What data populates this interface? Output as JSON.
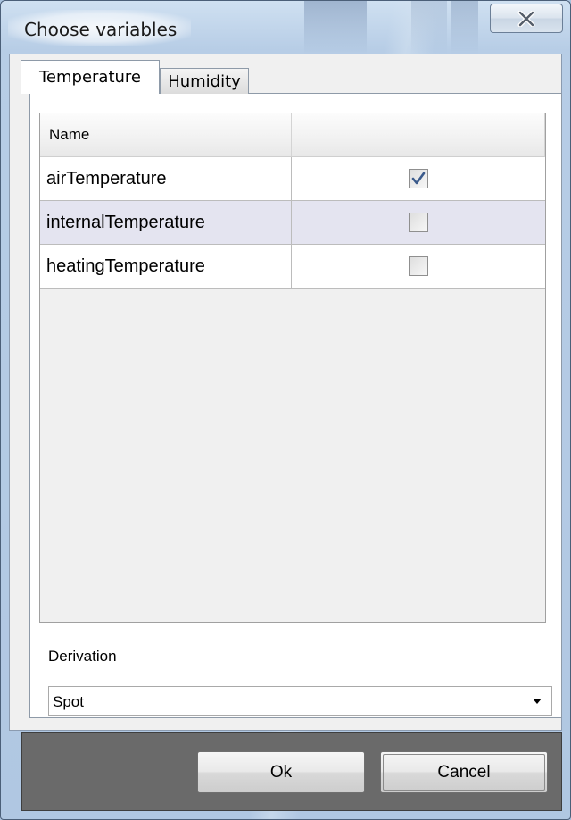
{
  "window": {
    "title": "Choose variables",
    "close_icon": "close-x-icon"
  },
  "tabs": [
    {
      "label": "Temperature",
      "active": true
    },
    {
      "label": "Humidity",
      "active": false
    }
  ],
  "table": {
    "columns": [
      "Name",
      ""
    ],
    "rows": [
      {
        "name": "airTemperature",
        "checked": true
      },
      {
        "name": "internalTemperature",
        "checked": false
      },
      {
        "name": "heatingTemperature",
        "checked": false
      }
    ]
  },
  "derivation": {
    "label": "Derivation",
    "selected": "Spot",
    "arrow_icon": "chevron-down-icon"
  },
  "buttons": {
    "ok": "Ok",
    "cancel": "Cancel"
  },
  "colors": {
    "row_alt_background": "#e4e4f0",
    "checkmark": "#3b5b8c",
    "button_bar": "#6a6a6a"
  }
}
